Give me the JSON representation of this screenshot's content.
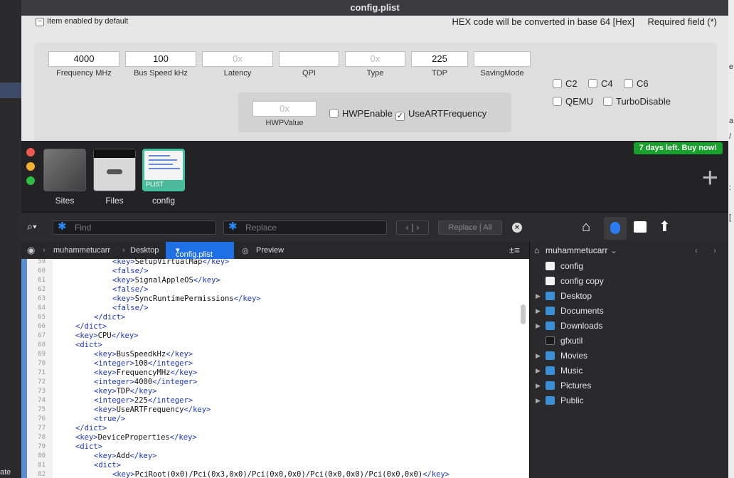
{
  "config_window": {
    "title": "config.plist",
    "item_enabled_label": "Item enabled by default",
    "hex_note": "HEX code will be converted in base 64 [Hex]",
    "required_note": "Required field (*)",
    "fields": {
      "frequency": {
        "value": "4000",
        "caption": "Frequency MHz"
      },
      "bus_speed": {
        "value": "100",
        "caption": "Bus Speed kHz"
      },
      "latency": {
        "placeholder": "0x",
        "caption": "Latency"
      },
      "qpi": {
        "value": "",
        "caption": "QPI"
      },
      "type": {
        "placeholder": "0x",
        "caption": "Type"
      },
      "tdp": {
        "value": "225",
        "caption": "TDP"
      },
      "saving_mode": {
        "value": "",
        "caption": "SavingMode"
      },
      "hwp_value": {
        "placeholder": "0x",
        "caption": "HWPValue"
      }
    },
    "checkboxes": {
      "c2": "C2",
      "c4": "C4",
      "c6": "C6",
      "qemu": "QEMU",
      "turbo_disable": "TurboDisable",
      "hwp_enable": "HWPEnable",
      "use_art_frequency": "UseARTFrequency"
    },
    "checked": {
      "use_art_frequency": true
    }
  },
  "editor": {
    "trial_badge": "7 days left. Buy now!",
    "tabs": [
      {
        "name": "Sites"
      },
      {
        "name": "Files"
      },
      {
        "name": "config",
        "tag": "PLIST"
      }
    ],
    "find_placeholder": "Find",
    "replace_placeholder": "Replace",
    "replace_button": "Replace",
    "replace_all_button": "All",
    "breadcrumbs": {
      "user": "muhammetucarr",
      "folder": "Desktop",
      "file": "config.plist",
      "preview": "Preview"
    },
    "code_lines": [
      {
        "n": "59",
        "indent": 3,
        "parts": [
          [
            "t",
            "<key>"
          ],
          [
            "x",
            "SetupVirtualMap"
          ],
          [
            "t",
            "</key>"
          ]
        ]
      },
      {
        "n": "60",
        "indent": 3,
        "parts": [
          [
            "t",
            "<false/>"
          ]
        ]
      },
      {
        "n": "61",
        "indent": 3,
        "parts": [
          [
            "t",
            "<key>"
          ],
          [
            "x",
            "SignalAppleOS"
          ],
          [
            "t",
            "</key>"
          ]
        ]
      },
      {
        "n": "62",
        "indent": 3,
        "parts": [
          [
            "t",
            "<false/>"
          ]
        ]
      },
      {
        "n": "63",
        "indent": 3,
        "parts": [
          [
            "t",
            "<key>"
          ],
          [
            "x",
            "SyncRuntimePermissions"
          ],
          [
            "t",
            "</key>"
          ]
        ]
      },
      {
        "n": "64",
        "indent": 3,
        "parts": [
          [
            "t",
            "<false/>"
          ]
        ]
      },
      {
        "n": "65",
        "indent": 2,
        "parts": [
          [
            "t",
            "</dict>"
          ]
        ]
      },
      {
        "n": "66",
        "indent": 1,
        "parts": [
          [
            "t",
            "</dict>"
          ]
        ]
      },
      {
        "n": "67",
        "indent": 1,
        "parts": [
          [
            "t",
            "<key>"
          ],
          [
            "x",
            "CPU"
          ],
          [
            "t",
            "</key>"
          ]
        ]
      },
      {
        "n": "68",
        "indent": 1,
        "parts": [
          [
            "t",
            "<dict>"
          ]
        ]
      },
      {
        "n": "69",
        "indent": 2,
        "parts": [
          [
            "t",
            "<key>"
          ],
          [
            "x",
            "BusSpeedkHz"
          ],
          [
            "t",
            "</key>"
          ]
        ]
      },
      {
        "n": "70",
        "indent": 2,
        "parts": [
          [
            "t",
            "<integer>"
          ],
          [
            "x",
            "100"
          ],
          [
            "t",
            "</integer>"
          ]
        ]
      },
      {
        "n": "71",
        "indent": 2,
        "parts": [
          [
            "t",
            "<key>"
          ],
          [
            "x",
            "FrequencyMHz"
          ],
          [
            "t",
            "</key>"
          ]
        ]
      },
      {
        "n": "72",
        "indent": 2,
        "parts": [
          [
            "t",
            "<integer>"
          ],
          [
            "x",
            "4000"
          ],
          [
            "t",
            "</integer>"
          ]
        ]
      },
      {
        "n": "73",
        "indent": 2,
        "parts": [
          [
            "t",
            "<key>"
          ],
          [
            "x",
            "TDP"
          ],
          [
            "t",
            "</key>"
          ]
        ]
      },
      {
        "n": "74",
        "indent": 2,
        "parts": [
          [
            "t",
            "<integer>"
          ],
          [
            "x",
            "225"
          ],
          [
            "t",
            "</integer>"
          ]
        ]
      },
      {
        "n": "75",
        "indent": 2,
        "parts": [
          [
            "t",
            "<key>"
          ],
          [
            "x",
            "UseARTFrequency"
          ],
          [
            "t",
            "</key>"
          ]
        ]
      },
      {
        "n": "76",
        "indent": 2,
        "parts": [
          [
            "t",
            "<true/>"
          ]
        ]
      },
      {
        "n": "77",
        "indent": 1,
        "parts": [
          [
            "t",
            "</dict>"
          ]
        ]
      },
      {
        "n": "78",
        "indent": 1,
        "parts": [
          [
            "t",
            "<key>"
          ],
          [
            "x",
            "DeviceProperties"
          ],
          [
            "t",
            "</key>"
          ]
        ]
      },
      {
        "n": "79",
        "indent": 1,
        "parts": [
          [
            "t",
            "<dict>"
          ]
        ]
      },
      {
        "n": "80",
        "indent": 2,
        "parts": [
          [
            "t",
            "<key>"
          ],
          [
            "x",
            "Add"
          ],
          [
            "t",
            "</key>"
          ]
        ]
      },
      {
        "n": "81",
        "indent": 2,
        "parts": [
          [
            "t",
            "<dict>"
          ]
        ]
      },
      {
        "n": "82",
        "indent": 3,
        "parts": [
          [
            "t",
            "<key>"
          ],
          [
            "x",
            "PciRoot(0x0)/Pci(0x3,0x0)/Pci(0x0,0x0)/Pci(0x0,0x0)/Pci(0x0,0x0)"
          ],
          [
            "t",
            "</key>"
          ]
        ]
      }
    ]
  },
  "file_browser": {
    "location": "muhammetucarr",
    "items": [
      {
        "name": "config",
        "kind": "plist",
        "expandable": false
      },
      {
        "name": "config copy",
        "kind": "plist",
        "expandable": false
      },
      {
        "name": "Desktop",
        "kind": "folder",
        "expandable": true
      },
      {
        "name": "Documents",
        "kind": "folder",
        "expandable": true
      },
      {
        "name": "Downloads",
        "kind": "folder",
        "expandable": true
      },
      {
        "name": "gfxutil",
        "kind": "exec",
        "expandable": false
      },
      {
        "name": "Movies",
        "kind": "folder",
        "expandable": true
      },
      {
        "name": "Music",
        "kind": "folder",
        "expandable": true
      },
      {
        "name": "Pictures",
        "kind": "folder",
        "expandable": true
      },
      {
        "name": "Public",
        "kind": "folder",
        "expandable": true
      }
    ]
  },
  "background": {
    "left_edge_text": "ate"
  },
  "colors": {
    "accent": "#1f6fe6",
    "trial": "#1aa02d",
    "xml_tag": "#1a35c2"
  }
}
